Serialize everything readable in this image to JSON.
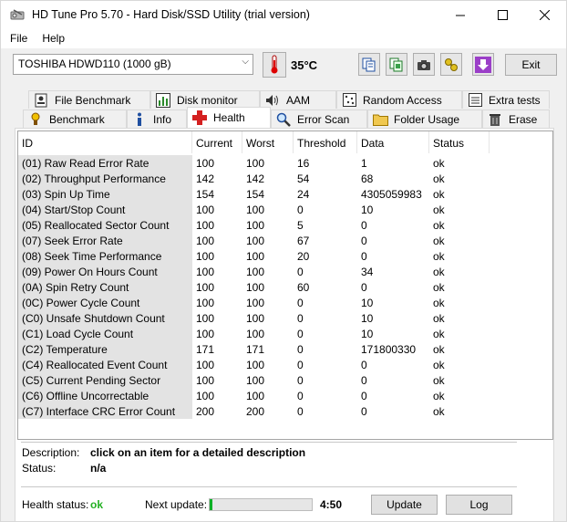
{
  "window": {
    "title": "HD Tune Pro 5.70 - Hard Disk/SSD Utility (trial version)"
  },
  "menu": {
    "file": "File",
    "help": "Help"
  },
  "toolbar": {
    "drive": "TOSHIBA HDWD110 (1000 gB)",
    "temperature": "35°C",
    "exit_label": "Exit"
  },
  "tabs_top": [
    {
      "label": "File Benchmark",
      "icon": "file-benchmark-icon"
    },
    {
      "label": "Disk monitor",
      "icon": "disk-monitor-icon"
    },
    {
      "label": "AAM",
      "icon": "speaker-icon"
    },
    {
      "label": "Random Access",
      "icon": "random-access-icon"
    },
    {
      "label": "Extra tests",
      "icon": "extra-tests-icon"
    }
  ],
  "tabs_bottom": [
    {
      "label": "Benchmark",
      "icon": "benchmark-icon"
    },
    {
      "label": "Info",
      "icon": "info-icon"
    },
    {
      "label": "Health",
      "icon": "health-cross-icon"
    },
    {
      "label": "Error Scan",
      "icon": "magnifier-icon"
    },
    {
      "label": "Folder Usage",
      "icon": "folder-icon"
    },
    {
      "label": "Erase",
      "icon": "trash-icon"
    }
  ],
  "table": {
    "headers": [
      "ID",
      "Current",
      "Worst",
      "Threshold",
      "Data",
      "Status"
    ],
    "rows": [
      [
        "(01) Raw Read Error Rate",
        "100",
        "100",
        "16",
        "1",
        "ok"
      ],
      [
        "(02) Throughput Performance",
        "142",
        "142",
        "54",
        "68",
        "ok"
      ],
      [
        "(03) Spin Up Time",
        "154",
        "154",
        "24",
        "4305059983",
        "ok"
      ],
      [
        "(04) Start/Stop Count",
        "100",
        "100",
        "0",
        "10",
        "ok"
      ],
      [
        "(05) Reallocated Sector Count",
        "100",
        "100",
        "5",
        "0",
        "ok"
      ],
      [
        "(07) Seek Error Rate",
        "100",
        "100",
        "67",
        "0",
        "ok"
      ],
      [
        "(08) Seek Time Performance",
        "100",
        "100",
        "20",
        "0",
        "ok"
      ],
      [
        "(09) Power On Hours Count",
        "100",
        "100",
        "0",
        "34",
        "ok"
      ],
      [
        "(0A) Spin Retry Count",
        "100",
        "100",
        "60",
        "0",
        "ok"
      ],
      [
        "(0C) Power Cycle Count",
        "100",
        "100",
        "0",
        "10",
        "ok"
      ],
      [
        "(C0) Unsafe Shutdown Count",
        "100",
        "100",
        "0",
        "10",
        "ok"
      ],
      [
        "(C1) Load Cycle Count",
        "100",
        "100",
        "0",
        "10",
        "ok"
      ],
      [
        "(C2) Temperature",
        "171",
        "171",
        "0",
        "171800330",
        "ok"
      ],
      [
        "(C4) Reallocated Event Count",
        "100",
        "100",
        "0",
        "0",
        "ok"
      ],
      [
        "(C5) Current Pending Sector",
        "100",
        "100",
        "0",
        "0",
        "ok"
      ],
      [
        "(C6) Offline Uncorrectable",
        "100",
        "100",
        "0",
        "0",
        "ok"
      ],
      [
        "(C7) Interface CRC Error Count",
        "200",
        "200",
        "0",
        "0",
        "ok"
      ]
    ]
  },
  "details": {
    "description_label": "Description:",
    "description_value": "click on an item for a detailed description",
    "status_label": "Status:",
    "status_value": "n/a"
  },
  "footer": {
    "health_label": "Health status:",
    "health_value": "ok",
    "health_color": "#22b022",
    "next_update_label": "Next update:",
    "next_update_value": "4:50",
    "progress_fraction": 0.03,
    "update_button": "Update",
    "log_button": "Log"
  }
}
